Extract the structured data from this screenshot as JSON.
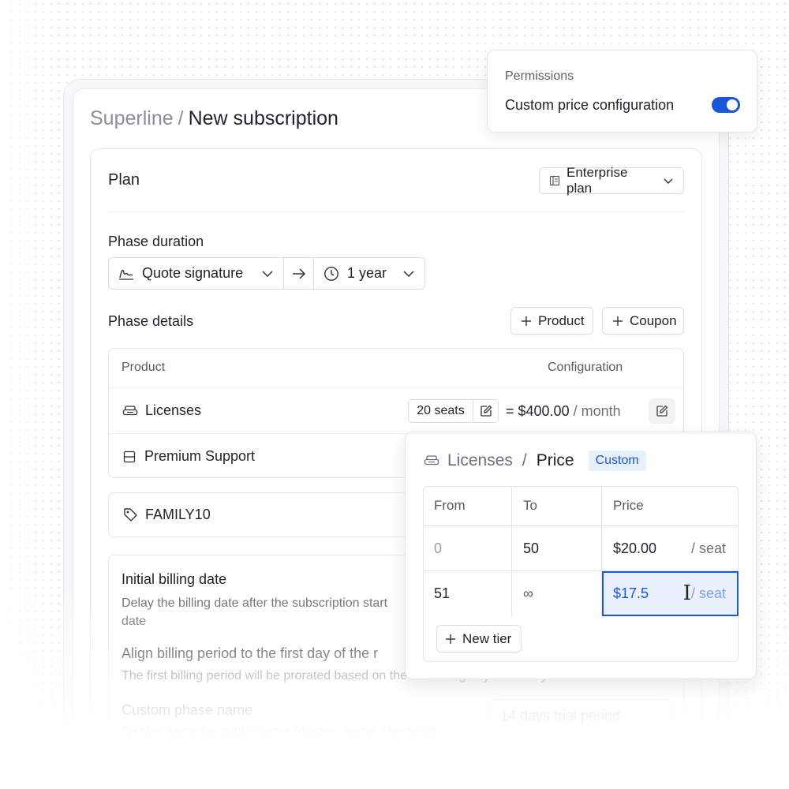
{
  "breadcrumb": {
    "parent": "Superline",
    "separator": "/",
    "current": "New subscription"
  },
  "plan": {
    "label": "Plan",
    "selected": "Enterprise plan"
  },
  "phase_duration": {
    "label": "Phase duration",
    "start": "Quote signature",
    "duration": "1 year"
  },
  "phase_details": {
    "label": "Phase details",
    "add_product": "Product",
    "add_coupon": "Coupon",
    "headers": {
      "product": "Product",
      "configuration": "Configuration"
    },
    "items": [
      {
        "name": "Licenses",
        "quantity": "20 seats",
        "price": "= $400.00",
        "period": "/ month"
      },
      {
        "name": "Premium Support"
      }
    ],
    "coupon": "FAMILY10"
  },
  "billing": {
    "initial_title": "Initial billing date",
    "initial_desc": "Delay the billing date after the subscription start date",
    "align_title": "Align billing period to the first day of the r",
    "align_desc": "The first billing period will be prorated based on the remaining days of the cycle",
    "custom_name_title": "Custom phase name",
    "custom_name_desc": "Display name for public pages (quotes, portal, checkout)",
    "custom_name_placeholder": "14 days trial period"
  },
  "permissions": {
    "title": "Permissions",
    "label": "Custom price configuration",
    "enabled": true
  },
  "price_popover": {
    "product": "Licenses",
    "separator": "/",
    "title": "Price",
    "badge": "Custom",
    "headers": {
      "from": "From",
      "to": "To",
      "price": "Price"
    },
    "tiers": [
      {
        "from": "0",
        "to": "50",
        "price": "$20.00",
        "unit": "/ seat"
      },
      {
        "from": "51",
        "to": "∞",
        "price": "$17.5",
        "unit": "/ seat"
      }
    ],
    "new_tier": "New tier"
  },
  "colors": {
    "accent": "#1a56db",
    "badge_bg": "#e8f0fe"
  }
}
